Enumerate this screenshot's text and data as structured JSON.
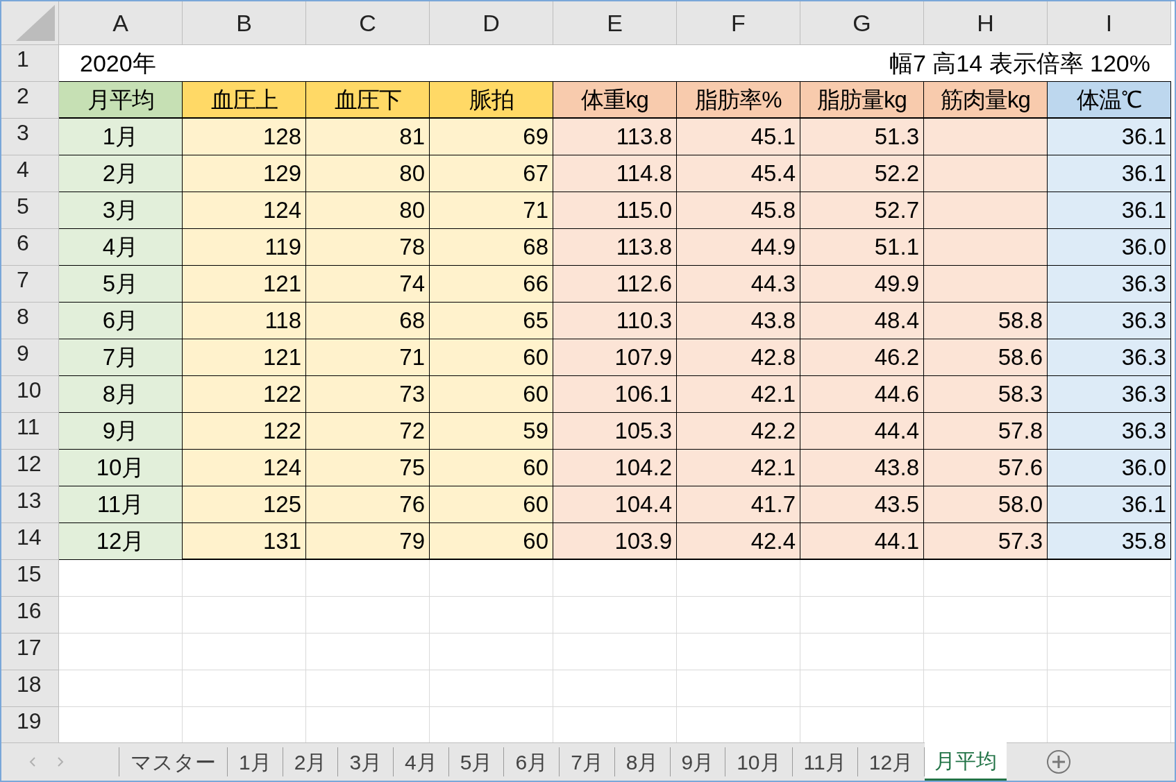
{
  "column_letters": [
    "A",
    "B",
    "C",
    "D",
    "E",
    "F",
    "G",
    "H",
    "I"
  ],
  "row_numbers": [
    "1",
    "2",
    "3",
    "4",
    "5",
    "6",
    "7",
    "8",
    "9",
    "10",
    "11",
    "12",
    "13",
    "14",
    "15",
    "16",
    "17",
    "18",
    "19"
  ],
  "title": "2020年",
  "note": "幅7 高14 表示倍率 120%",
  "headers": [
    {
      "label": "月平均",
      "kind": "month"
    },
    {
      "label": "血圧上",
      "kind": "vitals"
    },
    {
      "label": "血圧下",
      "kind": "vitals"
    },
    {
      "label": "脈拍",
      "kind": "vitals"
    },
    {
      "label": "体重kg",
      "kind": "body"
    },
    {
      "label": "脂肪率%",
      "kind": "body"
    },
    {
      "label": "脂肪量kg",
      "kind": "body"
    },
    {
      "label": "筋肉量kg",
      "kind": "body"
    },
    {
      "label": "体温℃",
      "kind": "temp"
    }
  ],
  "rows": [
    {
      "month": "1月",
      "bp_high": "128",
      "bp_low": "81",
      "pulse": "69",
      "weight": "113.8",
      "fat_rate": "45.1",
      "fat_mass": "51.3",
      "temp": "36.1"
    },
    {
      "month": "2月",
      "bp_high": "129",
      "bp_low": "80",
      "pulse": "67",
      "weight": "114.8",
      "fat_rate": "45.4",
      "fat_mass": "52.2",
      "temp": "36.1"
    },
    {
      "month": "3月",
      "bp_high": "124",
      "bp_low": "80",
      "pulse": "71",
      "weight": "115.0",
      "fat_rate": "45.8",
      "fat_mass": "52.7",
      "temp": "36.1"
    },
    {
      "month": "4月",
      "bp_high": "119",
      "bp_low": "78",
      "pulse": "68",
      "weight": "113.8",
      "fat_rate": "44.9",
      "fat_mass": "51.1",
      "temp": "36.0"
    },
    {
      "month": "5月",
      "bp_high": "121",
      "bp_low": "74",
      "pulse": "66",
      "weight": "112.6",
      "fat_rate": "44.3",
      "fat_mass": "49.9",
      "temp": "36.3"
    },
    {
      "month": "6月",
      "bp_high": "118",
      "bp_low": "68",
      "pulse": "65",
      "weight": "110.3",
      "fat_rate": "43.8",
      "fat_mass": "48.4",
      "muscle": "58.8",
      "temp": "36.3"
    },
    {
      "month": "7月",
      "bp_high": "121",
      "bp_low": "71",
      "pulse": "60",
      "weight": "107.9",
      "fat_rate": "42.8",
      "fat_mass": "46.2",
      "muscle": "58.6",
      "temp": "36.3"
    },
    {
      "month": "8月",
      "bp_high": "122",
      "bp_low": "73",
      "pulse": "60",
      "weight": "106.1",
      "fat_rate": "42.1",
      "fat_mass": "44.6",
      "muscle": "58.3",
      "temp": "36.3"
    },
    {
      "month": "9月",
      "bp_high": "122",
      "bp_low": "72",
      "pulse": "59",
      "weight": "105.3",
      "fat_rate": "42.2",
      "fat_mass": "44.4",
      "muscle": "57.8",
      "temp": "36.3"
    },
    {
      "month": "10月",
      "bp_high": "124",
      "bp_low": "75",
      "pulse": "60",
      "weight": "104.2",
      "fat_rate": "42.1",
      "fat_mass": "43.8",
      "muscle": "57.6",
      "temp": "36.0"
    },
    {
      "month": "11月",
      "bp_high": "125",
      "bp_low": "76",
      "pulse": "60",
      "weight": "104.4",
      "fat_rate": "41.7",
      "fat_mass": "43.5",
      "muscle": "58.0",
      "temp": "36.1"
    },
    {
      "month": "12月",
      "bp_high": "131",
      "bp_low": "79",
      "pulse": "60",
      "weight": "103.9",
      "fat_rate": "42.4",
      "fat_mass": "44.1",
      "muscle": "57.3",
      "temp": "35.8"
    }
  ],
  "sheet_tabs": [
    {
      "label": "マスター",
      "selected": false
    },
    {
      "label": "1月",
      "selected": false
    },
    {
      "label": "2月",
      "selected": false
    },
    {
      "label": "3月",
      "selected": false
    },
    {
      "label": "4月",
      "selected": false
    },
    {
      "label": "5月",
      "selected": false
    },
    {
      "label": "6月",
      "selected": false
    },
    {
      "label": "7月",
      "selected": false
    },
    {
      "label": "8月",
      "selected": false
    },
    {
      "label": "9月",
      "selected": false
    },
    {
      "label": "10月",
      "selected": false
    },
    {
      "label": "11月",
      "selected": false
    },
    {
      "label": "12月",
      "selected": false
    },
    {
      "label": "月平均",
      "selected": true
    }
  ]
}
